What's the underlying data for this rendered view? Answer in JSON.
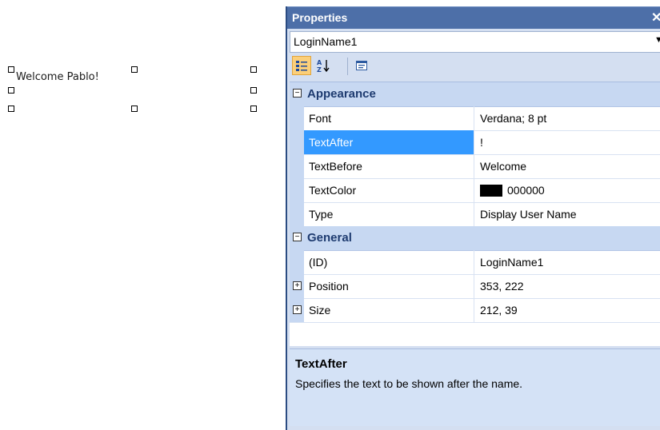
{
  "design": {
    "login_text": "Welcome Pablo!"
  },
  "properties": {
    "title": "Properties",
    "close_glyph": "✕",
    "selected_object": "LoginName1",
    "toolbar": {
      "categorized_icon": "categorized-icon",
      "alphabetical_icon": "alphabetical-sort-icon",
      "property_pages_icon": "property-pages-icon"
    },
    "categories": [
      {
        "name": "Appearance",
        "expander": "−",
        "rows": [
          {
            "name": "Font",
            "value": "Verdana; 8 pt"
          },
          {
            "name": "TextAfter",
            "value": "!"
          },
          {
            "name": "TextBefore",
            "value": "Welcome"
          },
          {
            "name": "TextColor",
            "value": "000000",
            "swatch_color": "#000000"
          },
          {
            "name": "Type",
            "value": "Display User Name"
          }
        ]
      },
      {
        "name": "General",
        "expander": "−",
        "rows": [
          {
            "name": "(ID)",
            "value": "LoginName1"
          },
          {
            "name": "Position",
            "value": "353, 222",
            "expander": "+"
          },
          {
            "name": "Size",
            "value": "212, 39",
            "expander": "+"
          }
        ]
      }
    ],
    "selected_property": "TextAfter",
    "description": {
      "title": "TextAfter",
      "text": "Specifies the text to be shown after the name."
    },
    "colors": {
      "title_bar": "#4d6fa8",
      "category_bg": "#c7d8f2",
      "selection": "#3399ff",
      "description_bg": "#d4e2f6"
    }
  }
}
